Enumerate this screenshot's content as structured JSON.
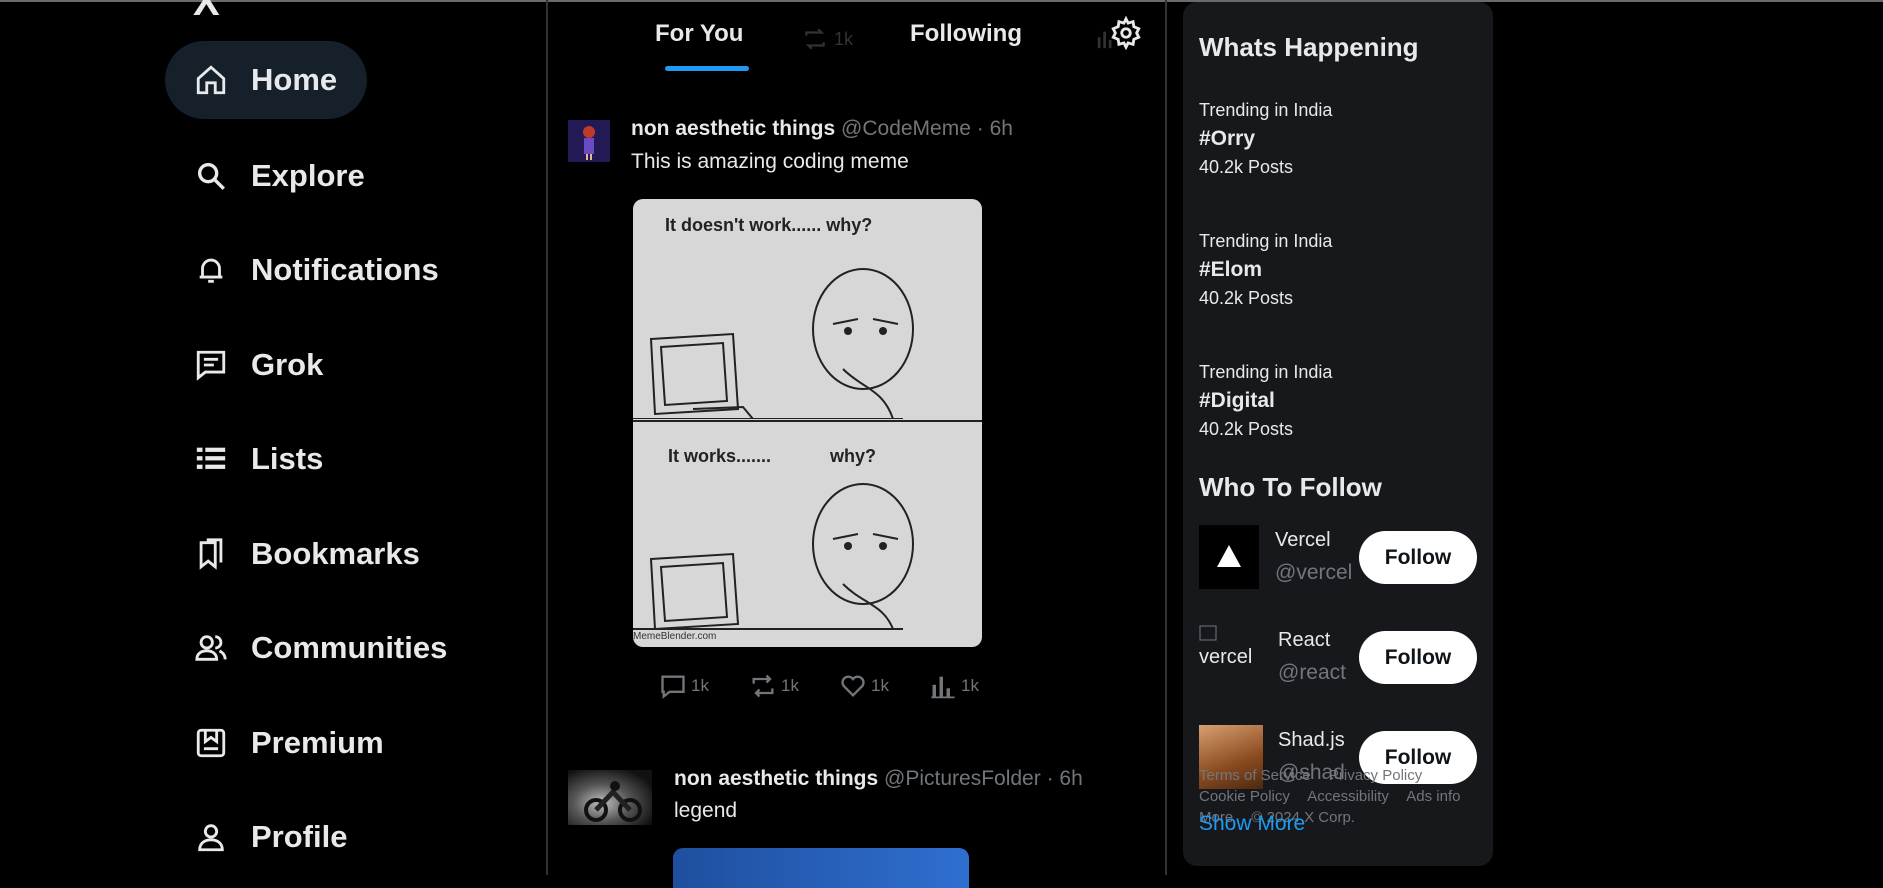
{
  "nav": {
    "logo": "X",
    "items": [
      {
        "label": "Home",
        "icon": "home-icon",
        "active": true
      },
      {
        "label": "Explore",
        "icon": "search-icon"
      },
      {
        "label": "Notifications",
        "icon": "bell-icon"
      },
      {
        "label": "Grok",
        "icon": "grok-icon"
      },
      {
        "label": "Lists",
        "icon": "list-icon"
      },
      {
        "label": "Bookmarks",
        "icon": "bookmark-icon"
      },
      {
        "label": "Communities",
        "icon": "people-icon"
      },
      {
        "label": "Premium",
        "icon": "premium-icon"
      },
      {
        "label": "Profile",
        "icon": "user-icon"
      }
    ]
  },
  "feed": {
    "tabs": [
      {
        "label": "For You",
        "active": true
      },
      {
        "label": "Following",
        "active": false
      }
    ],
    "faint_count": "1k",
    "posts": [
      {
        "author": "non aesthetic things",
        "handle": "@CodeMeme",
        "separator": "·",
        "time": "6h",
        "text": "This is amazing coding meme",
        "meme": {
          "top_caption": "It doesn't work...... why?",
          "bottom_caption_left": "It works.......",
          "bottom_caption_right": "why?",
          "footer": "MemeBlender.com"
        },
        "actions": {
          "reply": "1k",
          "retweet": "1k",
          "like": "1k",
          "views": "1k"
        }
      },
      {
        "author": "non aesthetic things",
        "handle": "@PicturesFolder",
        "separator": "·",
        "time": "6h",
        "text": "legend"
      }
    ]
  },
  "right_panel": {
    "happening_title": "Whats Happening",
    "trends": [
      {
        "context": "Trending in India",
        "tag": "#Orry",
        "count": "40.2k Posts"
      },
      {
        "context": "Trending in India",
        "tag": "#Elom",
        "count": "40.2k Posts"
      },
      {
        "context": "Trending in India",
        "tag": "#Digital",
        "count": "40.2k Posts"
      }
    ],
    "follow_title": "Who To Follow",
    "suggestions": [
      {
        "name": "Vercel",
        "handle": "@vercel",
        "button": "Follow"
      },
      {
        "name": "React",
        "handle": "@react",
        "button": "Follow",
        "alt_text": "vercel"
      },
      {
        "name": "Shad.js",
        "handle": "@shad",
        "button": "Follow"
      }
    ],
    "footer_links": [
      "Terms of Service",
      "Privacy Policy",
      "Cookie Policy",
      "Accessibility",
      "Ads info",
      "More",
      "© 2024 X Corp."
    ],
    "show_more": "Show More"
  },
  "colors": {
    "background": "#000000",
    "panel": "#16181c",
    "accent": "#1d9bf0",
    "muted": "#71767b",
    "active_nav": "#15202b"
  }
}
